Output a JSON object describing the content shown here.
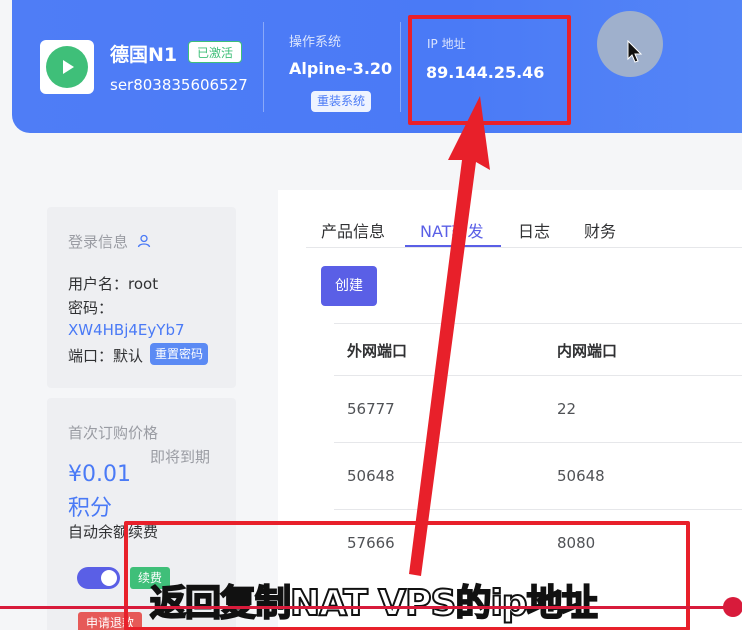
{
  "header": {
    "server_name": "德国N1",
    "status_badge": "已激活",
    "server_id": "ser803835606527",
    "os_label": "操作系统",
    "os_value": "Alpine-3.20",
    "reinstall_label": "重装系统",
    "ip_label": "IP 地址",
    "ip_value": "89.144.25.46"
  },
  "login_card": {
    "title": "登录信息",
    "username_row": "用户名：root",
    "password_label": "密码：",
    "password_value": "XW4HBj4EyYb7",
    "port_row": "端口：默认",
    "reset_label": "重置密码"
  },
  "price_card": {
    "title": "首次订购价格",
    "price": "¥0.01",
    "points": "积分",
    "expiring": "即将到期",
    "auto_renew": "自动余额续费",
    "renew_badge": "续费",
    "apply_label": "申请退款"
  },
  "tabs": [
    {
      "label": "产品信息",
      "active": false
    },
    {
      "label": "NAT转发",
      "active": true
    },
    {
      "label": "日志",
      "active": false
    },
    {
      "label": "财务",
      "active": false
    }
  ],
  "create_label": "创建",
  "table": {
    "headers": [
      "外网端口",
      "内网端口"
    ],
    "rows": [
      [
        "56777",
        "22"
      ],
      [
        "50648",
        "50648"
      ],
      [
        "57666",
        "8080"
      ]
    ]
  },
  "caption": "返回复制NAT VPS的ip地址",
  "colors": {
    "brand_blue": "#4a7af6",
    "accent_purple": "#5a5fe6",
    "success_green": "#3fbf79",
    "annotation_red": "#e8202a"
  }
}
